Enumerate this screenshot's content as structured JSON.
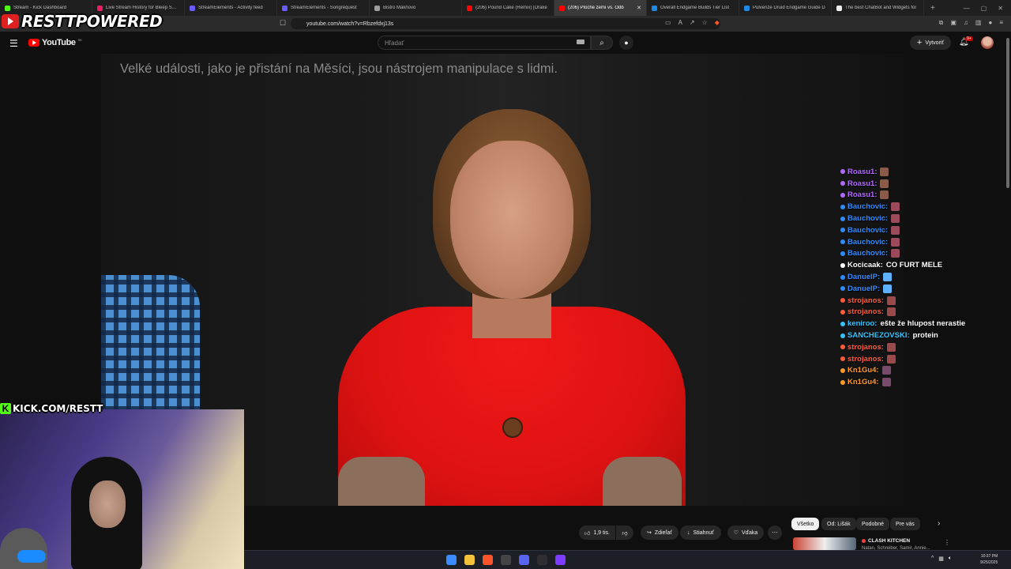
{
  "browser": {
    "tabs": [
      {
        "title": "Stream - Kick Dashboard",
        "color": "#53fc18",
        "active": false
      },
      {
        "title": "Live Stream History for Bleep Sharp",
        "color": "#e91e63",
        "active": false
      },
      {
        "title": "StreamElements - Activity feed",
        "color": "#6a5cff",
        "active": false
      },
      {
        "title": "StreamElements - Songrequest",
        "color": "#6a5cff",
        "active": false
      },
      {
        "title": "Bistro Maknovo",
        "color": "#9e9e9e",
        "active": false
      },
      {
        "title": "(206) Pound Cake (Remix) [Drake",
        "color": "#ff0000",
        "active": false
      },
      {
        "title": "(206) Ploché zemi vs. Odb",
        "color": "#ff0000",
        "active": true
      },
      {
        "title": "Overall Endgame Builds Tier List",
        "color": "#1e88e5",
        "active": false
      },
      {
        "title": "Pulverize Druid Endgame Guide D",
        "color": "#1e88e5",
        "active": false
      },
      {
        "title": "The best ChatBot and Widgets for",
        "color": "#eeeeee",
        "active": false
      }
    ],
    "url": "youtube.com/watch?v=Rbzefdxj13s"
  },
  "overlay": {
    "brand": "RESTTPOWERED",
    "kick_label": "KICK.COM/RESTT"
  },
  "youtube": {
    "logo_text": "YouTube",
    "country": "SK",
    "search_placeholder": "Hľadať",
    "create_label": "Vytvoriť",
    "notif_count": "9+"
  },
  "video": {
    "subtitle": "Velké události, jako je přistání na Měsíci, jsou nástrojem manipulace s lidmi."
  },
  "chat": [
    {
      "user": "Roasu1:",
      "color": "#b36bff",
      "msg": "",
      "emote": "#8a5a4a"
    },
    {
      "user": "Roasu1:",
      "color": "#b36bff",
      "msg": "",
      "emote": "#8a5a4a"
    },
    {
      "user": "Roasu1:",
      "color": "#b36bff",
      "msg": "",
      "emote": "#8a5a4a"
    },
    {
      "user": "Bauchovic:",
      "color": "#2f8cff",
      "msg": "",
      "emote": "#9a4a5a"
    },
    {
      "user": "Bauchovic:",
      "color": "#2f8cff",
      "msg": "",
      "emote": "#9a4a5a"
    },
    {
      "user": "Bauchovic:",
      "color": "#2f8cff",
      "msg": "",
      "emote": "#9a4a5a"
    },
    {
      "user": "Bauchovic:",
      "color": "#2f8cff",
      "msg": "",
      "emote": "#9a4a5a"
    },
    {
      "user": "Bauchovic:",
      "color": "#2f8cff",
      "msg": "",
      "emote": "#9a4a5a"
    },
    {
      "user": "Kocicaak:",
      "color": "#ffffff",
      "msg": "CO FURT MELE",
      "emote": ""
    },
    {
      "user": "DanuelP:",
      "color": "#2f8cff",
      "msg": "",
      "emote": "#5fb0ff"
    },
    {
      "user": "DanuelP:",
      "color": "#2f8cff",
      "msg": "",
      "emote": "#5fb0ff"
    },
    {
      "user": "strojanos:",
      "color": "#ff5a3c",
      "msg": "",
      "emote": "#9a4a4a"
    },
    {
      "user": "strojanos:",
      "color": "#ff5a3c",
      "msg": "",
      "emote": "#9a4a4a"
    },
    {
      "user": "keniroo:",
      "color": "#35c4ff",
      "msg": "ešte že hlupost nerastie",
      "emote": ""
    },
    {
      "user": "SANCHEZOVSKI:",
      "color": "#35c4ff",
      "msg": "protein",
      "emote": ""
    },
    {
      "user": "strojanos:",
      "color": "#ff5a3c",
      "msg": "",
      "emote": "#9a4a4a"
    },
    {
      "user": "strojanos:",
      "color": "#ff5a3c",
      "msg": "",
      "emote": "#9a4a4a"
    },
    {
      "user": "Kn1Gu4:",
      "color": "#ff9a2e",
      "msg": "",
      "emote": "#7a4a6a"
    },
    {
      "user": "Kn1Gu4:",
      "color": "#ff9a2e",
      "msg": "",
      "emote": "#7a4a6a"
    }
  ],
  "actions": {
    "likes": "1,9 tis.",
    "share": "Zdieľať",
    "download": "Stiahnuť",
    "thanks": "Vďaka",
    "more": "⋯"
  },
  "chips": [
    "Všetko",
    "Od: Lišák",
    "Podobné",
    "Pre vás"
  ],
  "recommendation": {
    "title": "CLASH KITCHEN",
    "subtitle": "Natan, Schreiber, Samir, Annie..."
  },
  "taskbar": {
    "time": "10:37 PM",
    "date": "9/25/2025"
  }
}
